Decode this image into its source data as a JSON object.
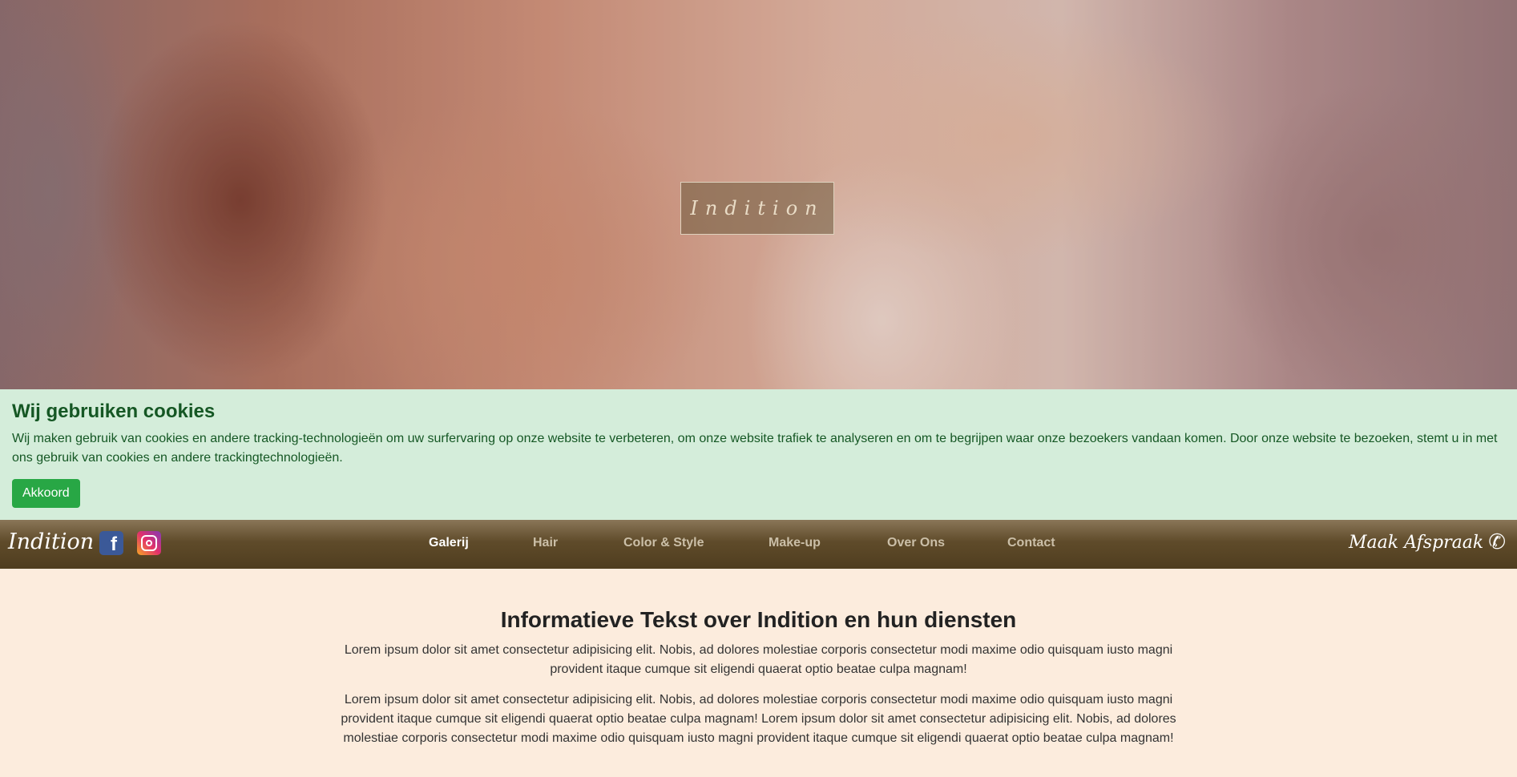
{
  "hero": {
    "logo_text": "Indition"
  },
  "cookie": {
    "title": "Wij gebruiken cookies",
    "text": "Wij maken gebruik van cookies en andere tracking-technologieën om uw surfervaring op onze website te verbeteren, om onze website trafiek te analyseren en om te begrijpen waar onze bezoekers vandaan komen. Door onze website te bezoeken, stemt u in met ons gebruik van cookies en andere trackingtechnologieën.",
    "accept_label": "Akkoord",
    "colors": {
      "background": "#d4edda",
      "text": "#155724",
      "button": "#28a745"
    }
  },
  "navbar": {
    "brand": "Indition",
    "social": [
      {
        "icon": "facebook-icon",
        "glyph": "f"
      },
      {
        "icon": "instagram-icon"
      }
    ],
    "links": [
      {
        "label": "Galerij",
        "active": true
      },
      {
        "label": "Hair",
        "active": false
      },
      {
        "label": "Color & Style",
        "active": false
      },
      {
        "label": "Make-up",
        "active": false
      },
      {
        "label": "Over Ons",
        "active": false
      },
      {
        "label": "Contact",
        "active": false
      }
    ],
    "cta_label": "Maak Afspraak",
    "cta_icon": "phone-icon",
    "phone_glyph": "✆"
  },
  "content": {
    "title": "Informatieve Tekst over Indition en hun diensten",
    "paragraphs": [
      "Lorem ipsum dolor sit amet consectetur adipisicing elit. Nobis, ad dolores molestiae corporis consectetur modi maxime odio quisquam iusto magni provident itaque cumque sit eligendi quaerat optio beatae culpa magnam!",
      "Lorem ipsum dolor sit amet consectetur adipisicing elit. Nobis, ad dolores molestiae corporis consectetur modi maxime odio quisquam iusto magni provident itaque cumque sit eligendi quaerat optio beatae culpa magnam! Lorem ipsum dolor sit amet consectetur adipisicing elit. Nobis, ad dolores molestiae corporis consectetur modi maxime odio quisquam iusto magni provident itaque cumque sit eligendi quaerat optio beatae culpa magnam!"
    ]
  }
}
